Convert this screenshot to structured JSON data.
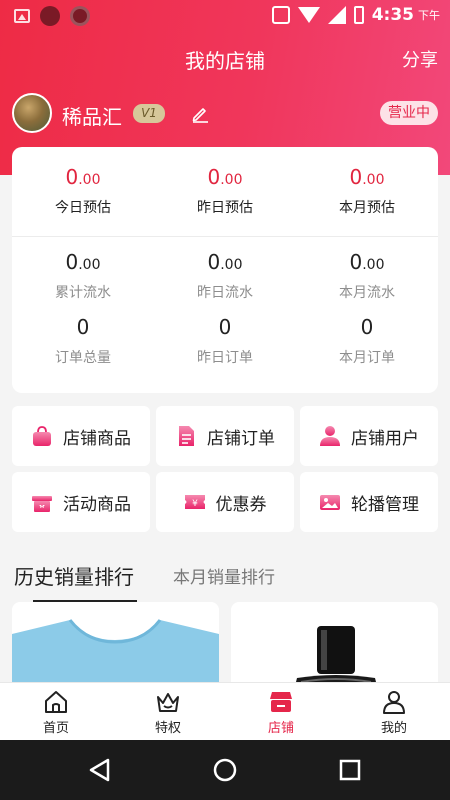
{
  "status_bar": {
    "time": "4:35",
    "ampm": "下午"
  },
  "header": {
    "title": "我的店铺",
    "share_label": "分享"
  },
  "shop": {
    "name": "稀品汇",
    "level": "V1",
    "status": "营业中"
  },
  "stats": {
    "today_estimate": {
      "value": "0",
      "decimal": ".00",
      "label": "今日预估"
    },
    "yesterday_estimate": {
      "value": "0",
      "decimal": ".00",
      "label": "昨日预估"
    },
    "month_estimate": {
      "value": "0",
      "decimal": ".00",
      "label": "本月预估"
    },
    "total_flow": {
      "value": "0",
      "decimal": ".00",
      "label": "累计流水"
    },
    "yesterday_flow": {
      "value": "0",
      "decimal": ".00",
      "label": "昨日流水"
    },
    "month_flow": {
      "value": "0",
      "decimal": ".00",
      "label": "本月流水"
    },
    "total_orders": {
      "value": "0",
      "label": "订单总量"
    },
    "yesterday_orders": {
      "value": "0",
      "label": "昨日订单"
    },
    "month_orders": {
      "value": "0",
      "label": "本月订单"
    }
  },
  "menu": [
    {
      "label": "店铺商品",
      "icon": "shopping-bag-icon"
    },
    {
      "label": "店铺订单",
      "icon": "order-document-icon"
    },
    {
      "label": "店铺用户",
      "icon": "user-icon"
    },
    {
      "label": "活动商品",
      "icon": "gift-box-icon"
    },
    {
      "label": "优惠券",
      "icon": "coupon-icon"
    },
    {
      "label": "轮播管理",
      "icon": "image-gallery-icon"
    }
  ],
  "ranking_tabs": {
    "history": "历史销量排行",
    "month": "本月销量排行"
  },
  "bottom_nav": [
    {
      "label": "首页",
      "icon": "home-icon"
    },
    {
      "label": "特权",
      "icon": "crown-icon"
    },
    {
      "label": "店铺",
      "icon": "store-icon",
      "active": true
    },
    {
      "label": "我的",
      "icon": "profile-icon"
    }
  ],
  "colors": {
    "accent": "#e5264a",
    "header_gradient_start": "#ee2b45",
    "header_gradient_end": "#f2487a",
    "vip_badge": "#d7c79a"
  }
}
